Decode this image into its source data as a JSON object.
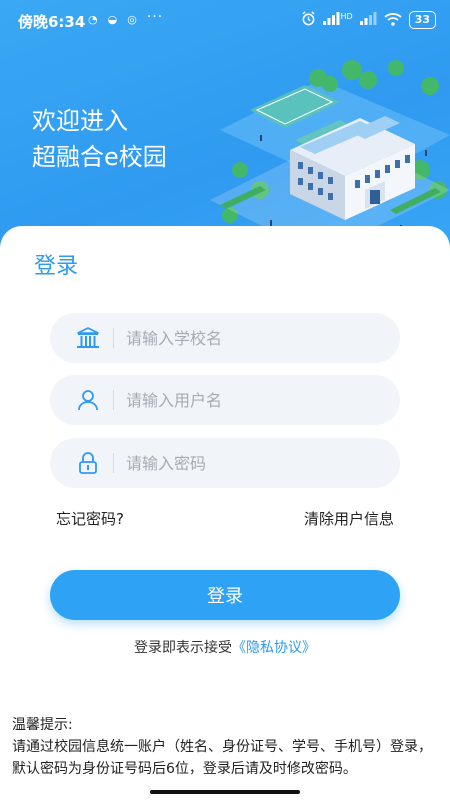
{
  "status_bar": {
    "time": "傍晚6:34",
    "more": "···",
    "network": "HD",
    "battery": "33"
  },
  "header": {
    "welcome_line1": "欢迎进入",
    "welcome_line2": "超融合e校园"
  },
  "login": {
    "title": "登录",
    "school_placeholder": "请输入学校名",
    "username_placeholder": "请输入用户名",
    "password_placeholder": "请输入密码",
    "forgot_password": "忘记密码?",
    "clear_user_info": "清除用户信息",
    "login_button": "登录",
    "agree_text": "登录即表示接受",
    "privacy_link": "《隐私协议》"
  },
  "tips": {
    "title": "温馨提示:",
    "body": "请通过校园信息统一账户（姓名、身份证号、学号、手机号）登录，默认密码为身份证号码后6位，登录后请及时修改密码。"
  },
  "colors": {
    "brand": "#2f9af0",
    "button": "#2ea3f5",
    "field_bg": "#f1f4f8"
  }
}
